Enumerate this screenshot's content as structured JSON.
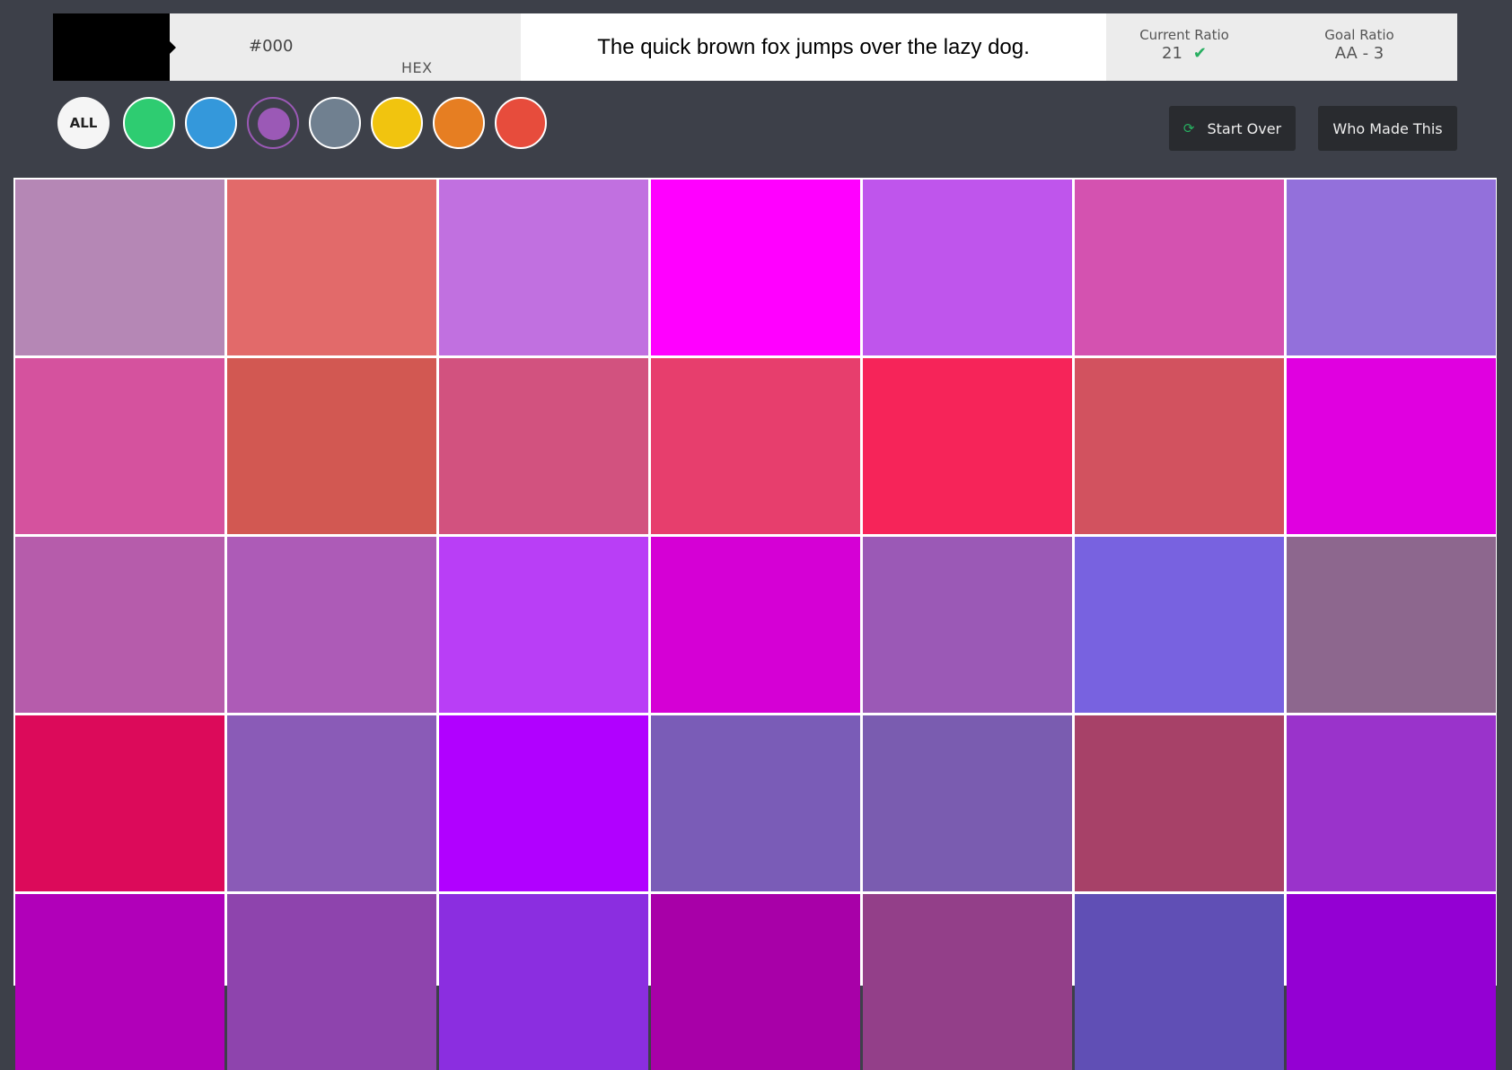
{
  "header": {
    "preview_color": "#000000",
    "hex_value": "#000",
    "hex_label": "HEX",
    "sample_text": "The quick brown fox jumps over the lazy dog.",
    "current_ratio_label": "Current Ratio",
    "current_ratio_value": "21",
    "goal_ratio_label": "Goal Ratio",
    "goal_ratio_value": "AA - 3",
    "check_icon": "check-icon"
  },
  "filters": {
    "all_label": "ALL",
    "colors": [
      "#2ecc71",
      "#3498db",
      "#9b59b6",
      "#708090",
      "#f1c40f",
      "#e67e22",
      "#e74c3c"
    ],
    "selected_index": 2
  },
  "buttons": {
    "start_over_label": "Start Over",
    "who_made_this_label": "Who Made This",
    "start_over_icon": "refresh-icon"
  },
  "grid": {
    "colors": [
      [
        "#b587b5",
        "#e26a6a",
        "#c170e0",
        "#ff00ff",
        "#bf55ec",
        "#d452b0",
        "#9370db"
      ],
      [
        "#d5529e",
        "#d25852",
        "#d2527f",
        "#e73e6d",
        "#f62459",
        "#d2525f",
        "#e000e0"
      ],
      [
        "#b65cab",
        "#ad5bb7",
        "#b93ef6",
        "#d500d5",
        "#9b59b6",
        "#7862e0",
        "#8d678e"
      ],
      [
        "#dc0a5a",
        "#8a5bb7",
        "#b100ff",
        "#7a5cb7",
        "#7a5cb0",
        "#a74168",
        "#9a33cb"
      ],
      [
        "#b100b9",
        "#8e44ad",
        "#8b2ee0",
        "#a800a8",
        "#933f89",
        "#604fb5",
        "#9400d3"
      ]
    ]
  }
}
